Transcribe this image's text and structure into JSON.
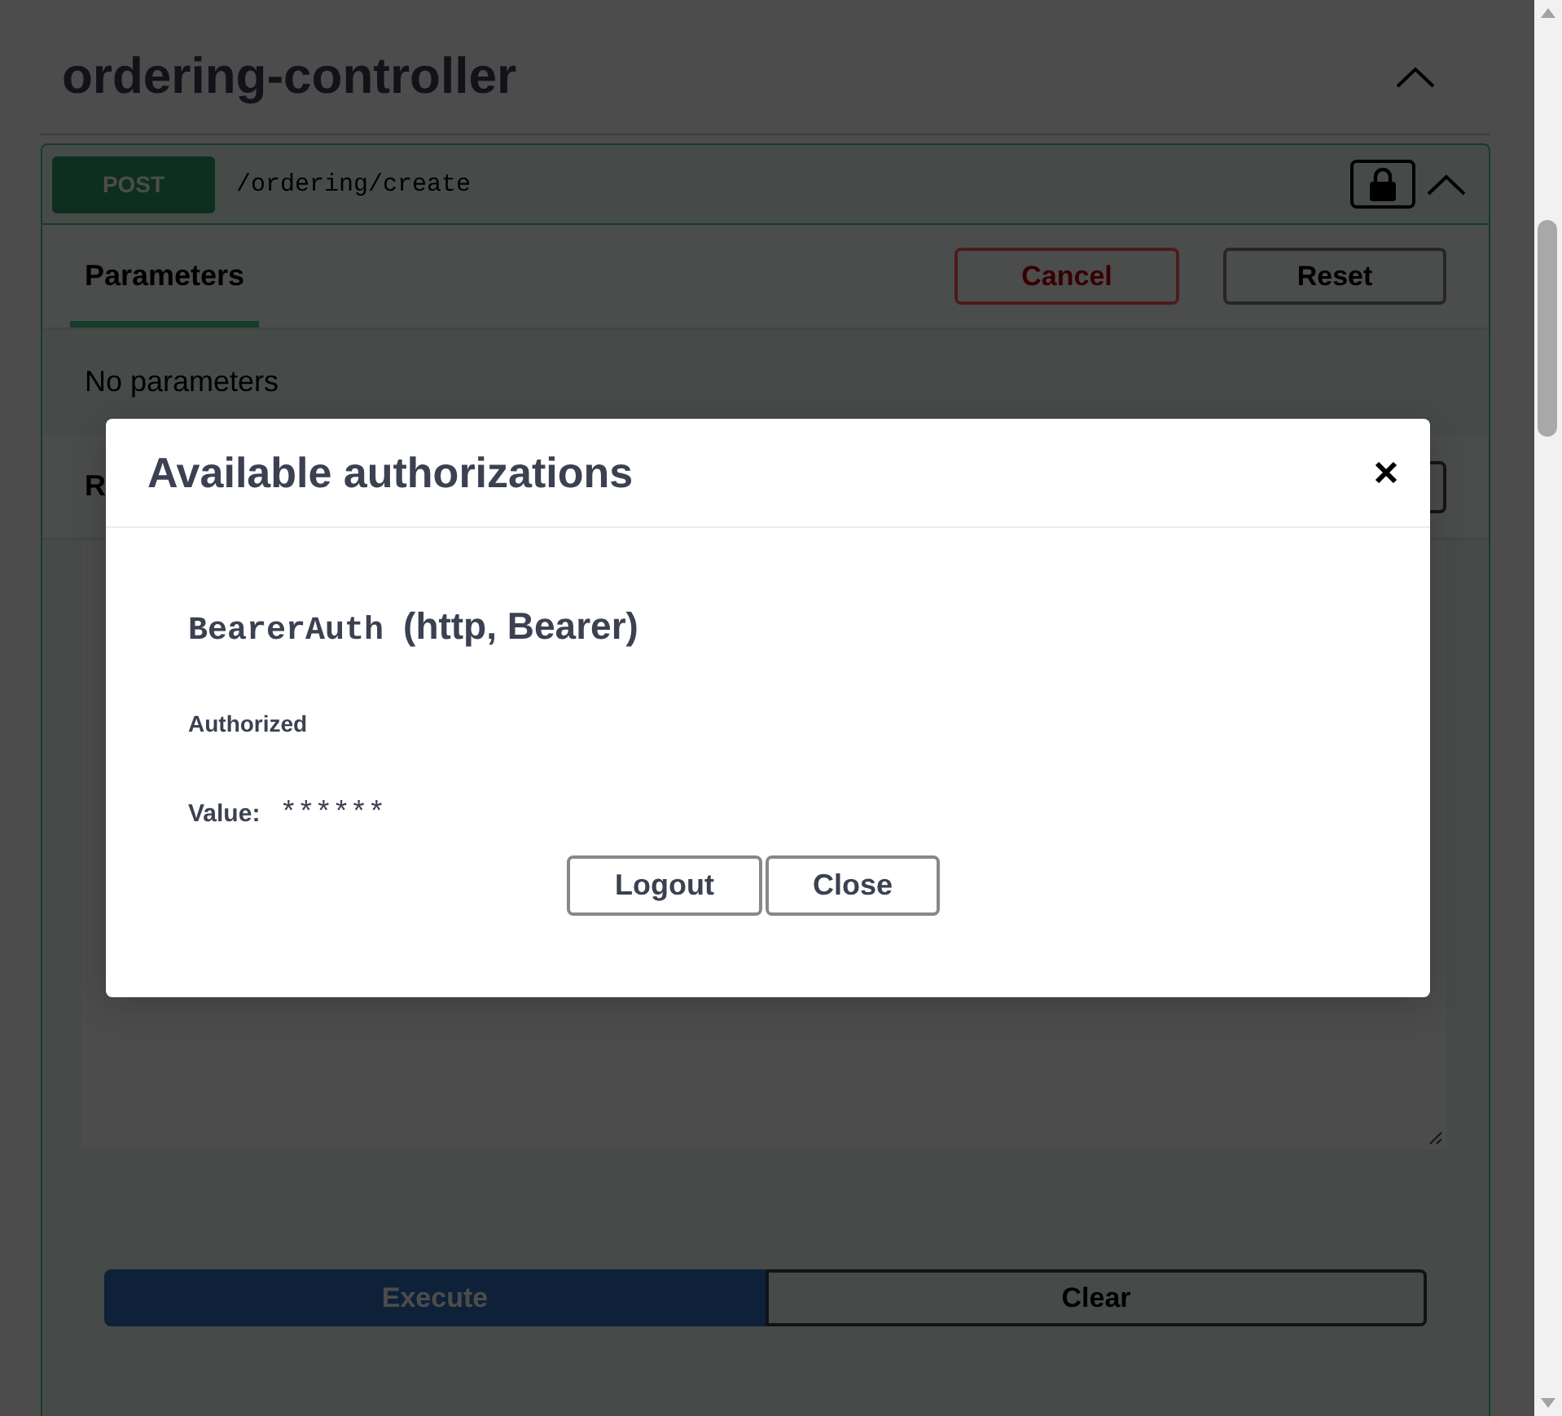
{
  "section": {
    "title": "ordering-controller",
    "expanded": true
  },
  "operation": {
    "method": "POST",
    "path": "/ordering/create",
    "locked": true,
    "expanded": true,
    "tabs": [
      {
        "label": "Parameters",
        "selected": true
      }
    ],
    "buttons": [
      {
        "label": "Cancel",
        "kind": "cancel"
      },
      {
        "label": "Reset",
        "kind": "reset"
      }
    ],
    "parameters_message": "No parameters",
    "request_body": {
      "title": "R"
    },
    "actions": [
      {
        "label": "Execute",
        "kind": "execute"
      },
      {
        "label": "Clear",
        "kind": "clear"
      }
    ]
  },
  "dialog": {
    "title": "Available authorizations",
    "schemes": [
      {
        "name": "BearerAuth",
        "type": "(http, Bearer)",
        "status": "Authorized",
        "value_label": "Value:",
        "value": "******"
      }
    ],
    "buttons": [
      {
        "label": "Logout",
        "kind": "logout"
      },
      {
        "label": "Close",
        "kind": "close"
      }
    ]
  }
}
